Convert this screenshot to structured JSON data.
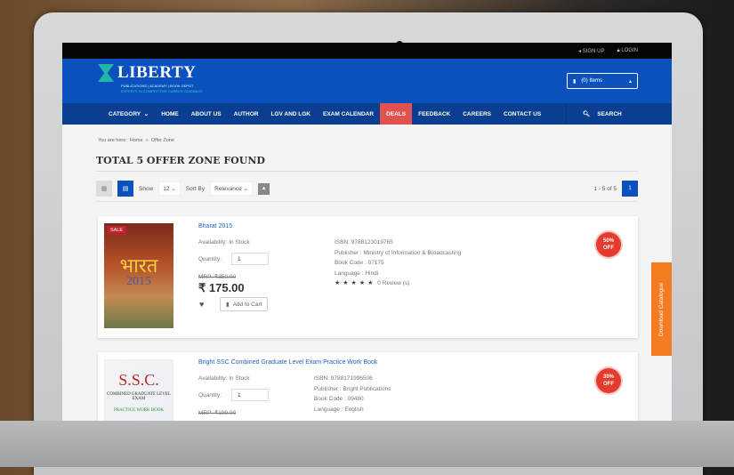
{
  "topbar": {
    "signup": "SIGN UP",
    "login": "LOGIN"
  },
  "logo": {
    "name": "LIBERTY",
    "tagline": "PUBLICATIONS | ACADEMY | BOOK DEPOT",
    "tagline2": "EXPERTS IN COMPETITIVE CAREER GUIDANCE"
  },
  "cart": {
    "label": "(0) Items"
  },
  "nav": {
    "items": [
      "CATEGORY",
      "HOME",
      "ABOUT US",
      "AUTHOR",
      "LGV AND LGK",
      "EXAM CALENDAR",
      "DEALS",
      "FEEDBACK",
      "CAREERS",
      "CONTACT US"
    ],
    "search": "SEARCH"
  },
  "breadcrumb": {
    "prefix": "You are here:",
    "home": "Home",
    "sep": "»",
    "current": "Offer Zone"
  },
  "page_title": "TOTAL 5 OFFER ZONE FOUND",
  "toolbar": {
    "show_label": "Show",
    "show_value": "12",
    "sort_label": "Sort By",
    "sort_value": "Relevance",
    "results": "1 - 5 of 5",
    "page": "1"
  },
  "products": [
    {
      "name": "Bharat 2015",
      "sale": "SALE",
      "cover_title": "भारत",
      "cover_year": "2015",
      "availability": "Availability: In Stock",
      "quantity_label": "Quantity:",
      "quantity": "1",
      "mrp": "MRP: ₹350.00",
      "price": "₹ 175.00",
      "add_to_cart": "Add to Cart",
      "isbn": "ISBN: 9788123019765",
      "publisher": "Publisher : Ministry of Information & Broadcasting",
      "book_code": "Book Code : 07175",
      "language": "Language : Hindi",
      "stars": "★★★★★",
      "reviews": "0 Review (s)",
      "discount": "50%",
      "off": "OFF"
    },
    {
      "name": "Bright SSC Combined Graduate Level Exam Practice Work Book",
      "cover_title": "S.S.C.",
      "cover_sub": "COMBINED GRADUATE LEVEL EXAM",
      "cover_sub2": "PRACTICE WORK BOOK",
      "availability": "Availability: In Stock",
      "quantity_label": "Quantity:",
      "quantity": "1",
      "mrp": "MRP: ₹199.00",
      "isbn": "ISBN: 9788171996506",
      "publisher": "Publisher : Bright Publications",
      "book_code": "Book Code : 09480",
      "language": "Language : English",
      "discount": "30%",
      "off": "OFF"
    }
  ],
  "download_catalogue": "Download Catalogue"
}
